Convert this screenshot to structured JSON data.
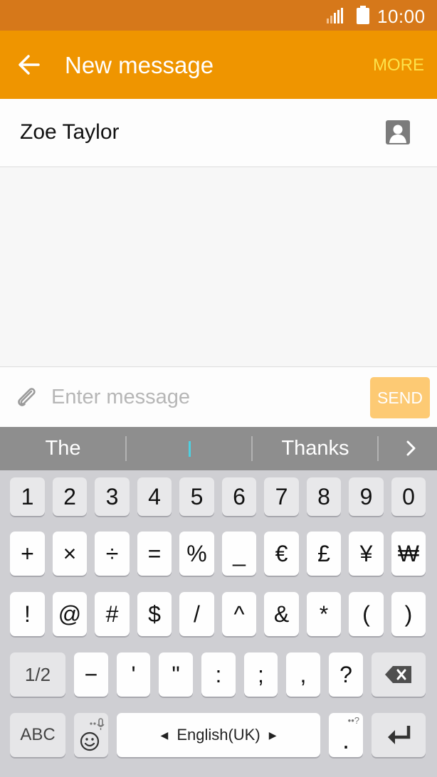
{
  "status_bar": {
    "time": "10:00",
    "signal_icon": "signal-icon",
    "battery_icon": "battery-icon"
  },
  "app_bar": {
    "title": "New message",
    "more_label": "MORE",
    "back_icon": "arrow-left-icon"
  },
  "recipient": {
    "name": "Zoe Taylor",
    "contact_icon": "contact-icon"
  },
  "composer": {
    "placeholder": "Enter message",
    "send_label": "SEND",
    "attach_icon": "paperclip-icon"
  },
  "suggestions": {
    "items": [
      "The",
      "",
      "Thanks"
    ],
    "expand_icon": "chevron-right-icon"
  },
  "keyboard": {
    "row1": [
      "1",
      "2",
      "3",
      "4",
      "5",
      "6",
      "7",
      "8",
      "9",
      "0"
    ],
    "row2": [
      "+",
      "×",
      "÷",
      "=",
      "%",
      "_",
      "€",
      "£",
      "¥",
      "₩"
    ],
    "row3": [
      "!",
      "@",
      "#",
      "$",
      "/",
      "^",
      "&",
      "*",
      "(",
      ")"
    ],
    "row4": [
      "1/2",
      "−",
      "'",
      "\"",
      ":",
      ";",
      ",",
      "?"
    ],
    "row5": {
      "abc": "ABC",
      "space": "English(UK)",
      "period": "."
    },
    "icons": {
      "backspace": "backspace-icon",
      "emoji": "emoji-icon",
      "enter": "enter-icon"
    }
  },
  "colors": {
    "status_bar": "#d6781a",
    "app_bar": "#ef9500",
    "more": "#fde24a",
    "send": "#fdca74",
    "suggestion_bar": "#8e8e8e",
    "keyboard": "#cfcfd3"
  }
}
